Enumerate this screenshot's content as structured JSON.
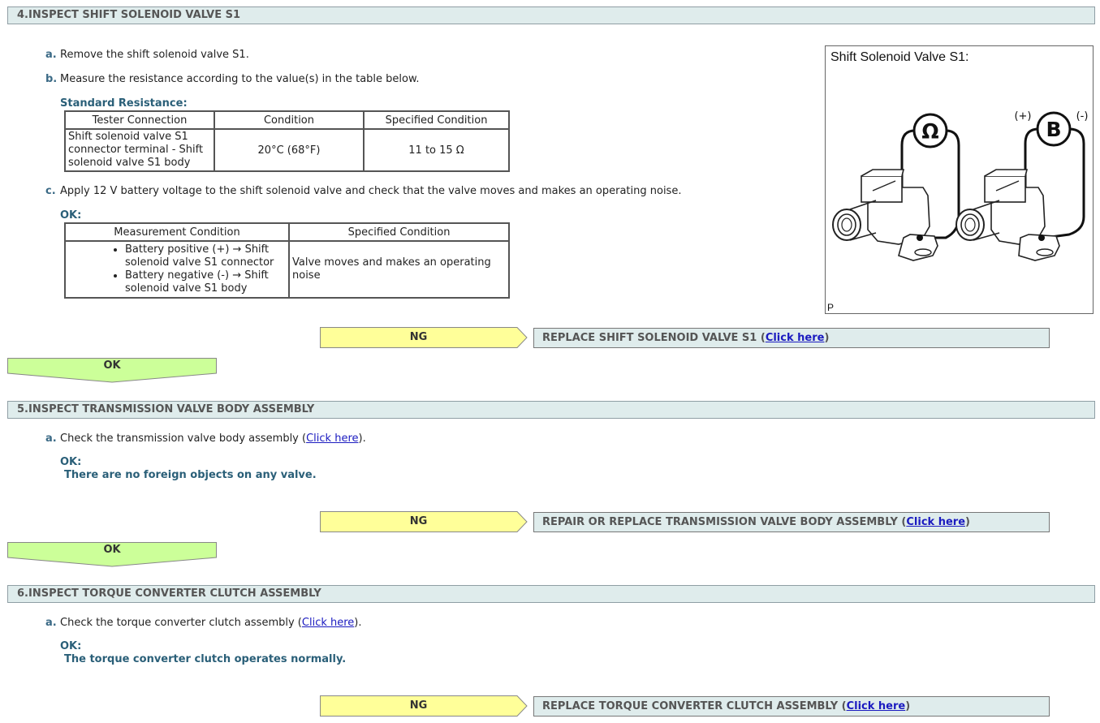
{
  "section4": {
    "title": "4.INSPECT SHIFT SOLENOID VALVE S1",
    "step_a": {
      "letter": "a.",
      "text": "Remove the shift solenoid valve S1."
    },
    "step_b": {
      "letter": "b.",
      "text": "Measure the resistance according to the value(s) in the table below."
    },
    "standard_label": "Standard Resistance:",
    "resistance_table": {
      "headers": [
        "Tester Connection",
        "Condition",
        "Specified Condition"
      ],
      "row": [
        "Shift solenoid valve S1 connector terminal - Shift solenoid valve S1 body",
        "20°C (68°F)",
        "11 to 15 Ω"
      ]
    },
    "step_c": {
      "letter": "c.",
      "text": "Apply 12 V battery voltage to the shift solenoid valve and check that the valve moves and makes an operating noise."
    },
    "ok_label": "OK:",
    "operation_table": {
      "headers": [
        "Measurement Condition",
        "Specified Condition"
      ],
      "bullets": [
        "Battery positive (+) → Shift solenoid valve S1 connector",
        "Battery negative (-) → Shift solenoid valve S1 body"
      ],
      "result": "Valve moves and makes an operating noise"
    },
    "figure": {
      "title": "Shift Solenoid Valve S1:",
      "ohm_symbol": "Ω",
      "battery_symbol": "B",
      "plus_label": "(+)",
      "minus_label": "(-)",
      "corner_label": "P"
    },
    "ng_label": "NG",
    "ng_result": "REPLACE SHIFT SOLENOID VALVE S1 (",
    "ng_link": "Click here",
    "ng_close": ")",
    "ok_arrow": "OK"
  },
  "section5": {
    "title": "5.INSPECT TRANSMISSION VALVE BODY ASSEMBLY",
    "step_a": {
      "letter": "a.",
      "text": "Check the transmission valve body assembly (",
      "link": "Click here",
      "close": ")."
    },
    "ok_label": "OK:",
    "ok_text": "There are no foreign objects on any valve.",
    "ng_label": "NG",
    "ng_result": "REPAIR OR REPLACE TRANSMISSION VALVE BODY ASSEMBLY (",
    "ng_link": "Click here",
    "ng_close": ")",
    "ok_arrow": "OK"
  },
  "section6": {
    "title": "6.INSPECT TORQUE CONVERTER CLUTCH ASSEMBLY",
    "step_a": {
      "letter": "a.",
      "text": "Check the torque converter clutch assembly (",
      "link": "Click here",
      "close": ")."
    },
    "ok_label": "OK:",
    "ok_text": "The torque converter clutch operates normally.",
    "ng_label": "NG",
    "ng_result": "REPLACE TORQUE CONVERTER CLUTCH ASSEMBLY (",
    "ng_link": "Click here",
    "ng_close": ")"
  },
  "colors": {
    "header_bg": "#dfecec",
    "ng_arrow": "#ffff99",
    "ok_arrow": "#ccff99",
    "label_text": "#2a5f78",
    "link": "#1b1bc0"
  }
}
